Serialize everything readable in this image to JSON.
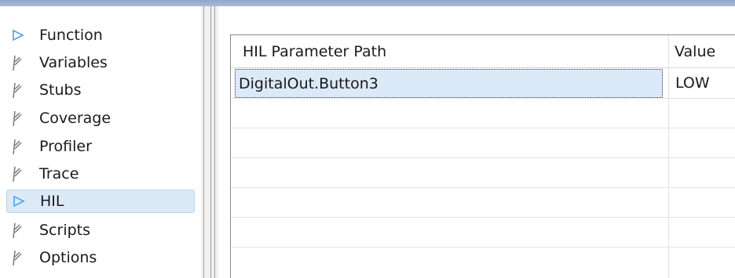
{
  "sidebar": {
    "items": [
      {
        "label": "Function",
        "icon": "play-arrow-icon",
        "selected": false
      },
      {
        "label": "Variables",
        "icon": "pen-icon",
        "selected": false
      },
      {
        "label": "Stubs",
        "icon": "pen-icon",
        "selected": false
      },
      {
        "label": "Coverage",
        "icon": "pen-icon",
        "selected": false
      },
      {
        "label": "Profiler",
        "icon": "pen-icon",
        "selected": false
      },
      {
        "label": "Trace",
        "icon": "pen-icon",
        "selected": false
      },
      {
        "label": "HIL",
        "icon": "play-arrow-icon",
        "selected": true
      },
      {
        "label": "Scripts",
        "icon": "pen-icon",
        "selected": false
      },
      {
        "label": "Options",
        "icon": "pen-icon",
        "selected": false
      }
    ]
  },
  "table": {
    "columns": [
      "HIL Parameter Path",
      "Value"
    ],
    "rows": [
      {
        "path": "DigitalOut.Button3",
        "value": "LOW",
        "selected": true
      },
      {
        "path": "",
        "value": "",
        "selected": false
      },
      {
        "path": "",
        "value": "",
        "selected": false
      },
      {
        "path": "",
        "value": "",
        "selected": false
      },
      {
        "path": "",
        "value": "",
        "selected": false
      },
      {
        "path": "",
        "value": "",
        "selected": false
      }
    ]
  },
  "colors": {
    "accent_arrow": "#5aa9e6",
    "selection": "#dce9f8",
    "header_bar": "#a9bcd6"
  }
}
